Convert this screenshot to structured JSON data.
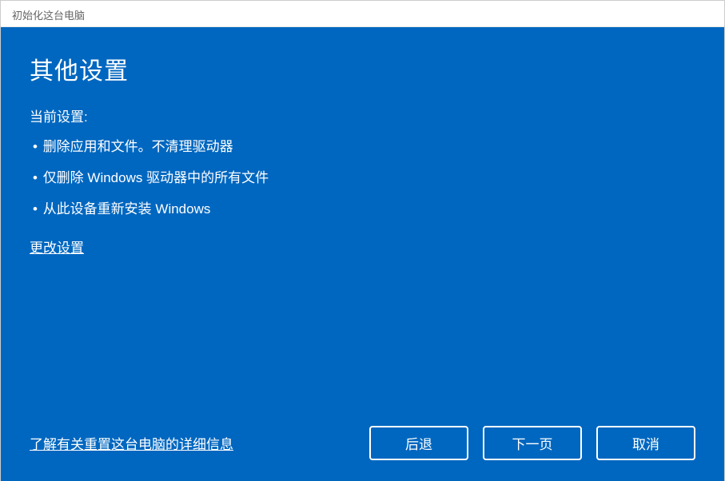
{
  "titlebar": {
    "title": "初始化这台电脑"
  },
  "main": {
    "heading": "其他设置",
    "current_settings_label": "当前设置:",
    "settings": [
      "删除应用和文件。不清理驱动器",
      "仅删除 Windows 驱动器中的所有文件",
      " 从此设备重新安装 Windows"
    ],
    "change_settings_link": "更改设置"
  },
  "footer": {
    "learn_more_link": "了解有关重置这台电脑的详细信息",
    "buttons": {
      "back": "后退",
      "next": "下一页",
      "cancel": "取消"
    }
  }
}
